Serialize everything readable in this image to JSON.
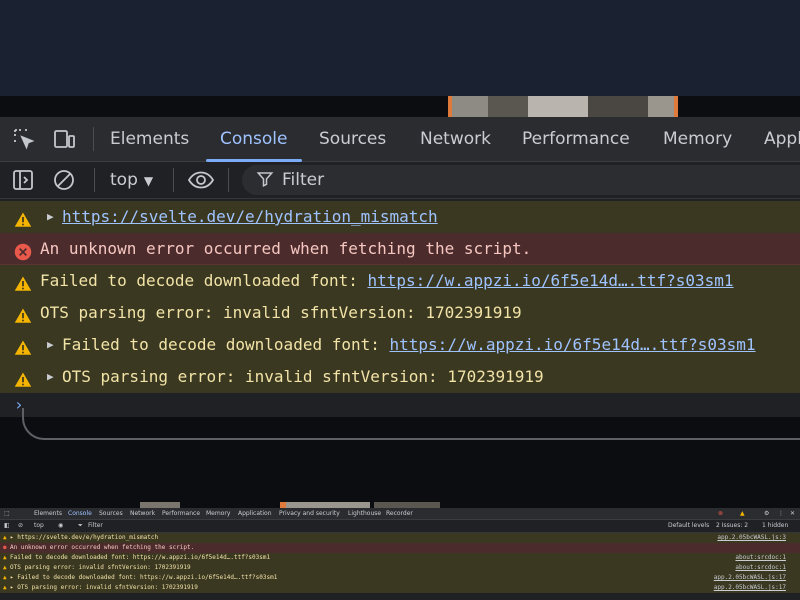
{
  "devtools": {
    "tabs": [
      "Elements",
      "Console",
      "Sources",
      "Network",
      "Performance",
      "Memory",
      "Appl"
    ],
    "active_tab": "Console",
    "context": "top",
    "filter_placeholder": "Filter"
  },
  "console": {
    "messages": [
      {
        "level": "warning",
        "expandable": true,
        "text": "",
        "link": "https://svelte.dev/e/hydration_mismatch"
      },
      {
        "level": "error",
        "expandable": false,
        "text": "An unknown error occurred when fetching the script.",
        "link": ""
      },
      {
        "level": "warning",
        "expandable": false,
        "text": "Failed to decode downloaded font: ",
        "link": "https://w.appzi.io/6f5e14d….ttf?s03sm1"
      },
      {
        "level": "warning",
        "expandable": false,
        "text": "OTS parsing error: invalid sfntVersion: 1702391919",
        "link": ""
      },
      {
        "level": "warning",
        "expandable": true,
        "text": "Failed to decode downloaded font: ",
        "link": "https://w.appzi.io/6f5e14d….ttf?s03sm1"
      },
      {
        "level": "warning",
        "expandable": true,
        "text": "OTS parsing error: invalid sfntVersion: 1702391919",
        "link": ""
      }
    ],
    "prompt": "›"
  },
  "mini": {
    "tabs": [
      "Elements",
      "Console",
      "Sources",
      "Network",
      "Performance",
      "Memory",
      "Application",
      "Privacy and security",
      "Lighthouse",
      "Recorder"
    ],
    "active_tab": "Console",
    "context": "top",
    "filter_placeholder": "Filter",
    "default_levels": "Default levels",
    "issues": "2 Issues: 2",
    "hidden": "1 hidden",
    "rows": [
      {
        "level": "warning",
        "text": "▸ https://svelte.dev/e/hydration_mismatch",
        "source": "app.2.05bcWASL.js:3"
      },
      {
        "level": "error",
        "text": "An unknown error occurred when fetching the script.",
        "source": ""
      },
      {
        "level": "warning",
        "text": "Failed to decode downloaded font: https://w.appzi.io/6f5e14d….ttf?s03sm1",
        "source": "about:srcdoc:1"
      },
      {
        "level": "warning",
        "text": "OTS parsing error: invalid sfntVersion: 1702391919",
        "source": "about:srcdoc:1"
      },
      {
        "level": "warning",
        "text": "▸ Failed to decode downloaded font: https://w.appzi.io/6f5e14d….ttf?s03sm1",
        "source": "app.2.05bcWASL.js:17"
      },
      {
        "level": "warning",
        "text": "▸ OTS parsing error: invalid sfntVersion: 1702391919",
        "source": "app.2.05bcWASL.js:17"
      }
    ]
  },
  "colors": {
    "accent": "#7cacf8",
    "warning_bg": "#3b3822",
    "error_bg": "#4b2b2b",
    "warning_icon": "#f4b400",
    "error_icon": "#e8594c"
  }
}
